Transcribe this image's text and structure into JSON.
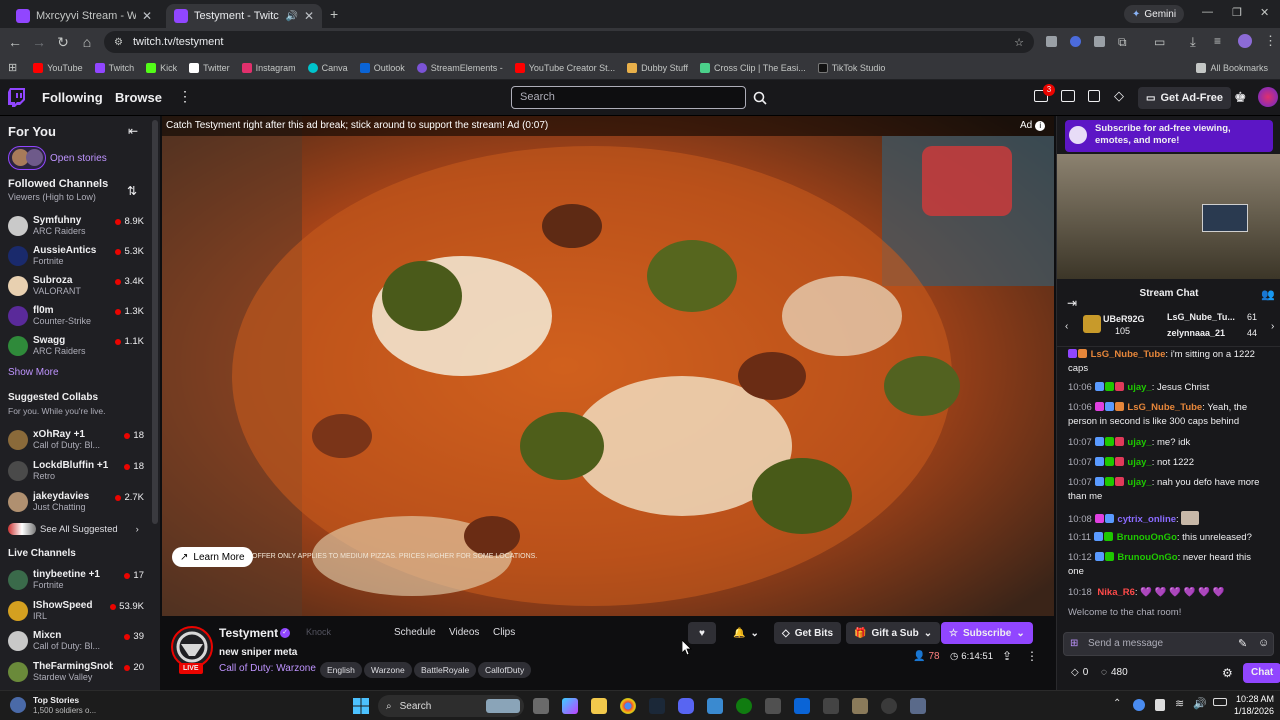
{
  "browser": {
    "tabs": [
      {
        "title": "Mxrcyyvi Stream - Watch Li",
        "active": false
      },
      {
        "title": "Testyment - Twitch",
        "active": true
      }
    ],
    "gemini_label": "Gemini",
    "url": "twitch.tv/testyment",
    "bookmarks": [
      "YouTube",
      "Twitch",
      "Kick",
      "Twitter",
      "Instagram",
      "Canva",
      "Outlook",
      "StreamElements -",
      "YouTube Creator St...",
      "Dubby Stuff",
      "Cross Clip | The Easi...",
      "TikTok Studio"
    ],
    "all_bookmarks": "All Bookmarks"
  },
  "topnav": {
    "following": "Following",
    "browse": "Browse",
    "search_placeholder": "Search",
    "notif_count": "3",
    "get_ad_free": "Get Ad-Free"
  },
  "sidebar": {
    "for_you": "For You",
    "open_stories": "Open stories",
    "followed_title": "Followed Channels",
    "followed_sort": "Viewers (High to Low)",
    "followed": [
      {
        "name": "Symfuhny",
        "game": "ARC Raiders",
        "viewers": "8.9K"
      },
      {
        "name": "AussieAntics",
        "game": "Fortnite",
        "viewers": "5.3K"
      },
      {
        "name": "Subroza",
        "game": "VALORANT",
        "viewers": "3.4K"
      },
      {
        "name": "fl0m",
        "game": "Counter-Strike",
        "viewers": "1.3K"
      },
      {
        "name": "Swagg",
        "game": "ARC Raiders",
        "viewers": "1.1K"
      }
    ],
    "show_more": "Show More",
    "collabs_title": "Suggested Collabs",
    "collabs_sub": "For you. While you're live.",
    "collabs": [
      {
        "name": "xOhRay +1",
        "game": "Call of Duty: Bl...",
        "viewers": "18"
      },
      {
        "name": "LockdBluffin +1",
        "game": "Retro",
        "viewers": "18"
      },
      {
        "name": "jakeydavies",
        "game": "Just Chatting",
        "viewers": "2.7K"
      }
    ],
    "see_all": "See All Suggested",
    "live_title": "Live Channels",
    "live": [
      {
        "name": "tinybeetine +1",
        "game": "Fortnite",
        "viewers": "17"
      },
      {
        "name": "IShowSpeed",
        "game": "IRL",
        "viewers": "53.9K"
      },
      {
        "name": "Mixcn",
        "game": "Call of Duty: Bl...",
        "viewers": "39"
      },
      {
        "name": "TheFarmingSnob",
        "game": "Stardew Valley",
        "viewers": "20"
      }
    ]
  },
  "video": {
    "ad_banner": "Catch Testyment right after this ad break; stick around to support the stream! Ad (0:07)",
    "ad_badge": "Ad",
    "learn_more": "Learn More",
    "disclaimer_1": "OFFER ONLY APPLIES TO MEDIUM PIZZAS. PRICES HIGHER FOR SOME LOCATIONS."
  },
  "channel": {
    "name": "Testyment",
    "title": "new sniper meta",
    "game": "Call of Duty: Warzone",
    "tags": [
      "English",
      "Warzone",
      "BattleRoyale",
      "CallofDuty"
    ],
    "live_label": "LIVE",
    "knock": "Knock",
    "tabs": [
      "Schedule",
      "Videos",
      "Clips"
    ],
    "get_bits": "Get Bits",
    "gift_sub": "Gift a Sub",
    "subscribe": "Subscribe",
    "viewers": "78",
    "uptime": "6:14:51"
  },
  "chat": {
    "promo": "Subscribe for ad-free viewing, emotes, and more!",
    "title": "Stream Chat",
    "gifters": [
      {
        "name": "UBeR92G",
        "count": "105"
      },
      {
        "name": "LsG_Nube_Tu...",
        "count": "61"
      },
      {
        "name": "zelynnaaa_21",
        "count": "44"
      }
    ],
    "messages": [
      {
        "time": "",
        "user": "LsG_Nube_Tube",
        "color": "#e6863a",
        "text": "i'm sitting on a 1222 caps"
      },
      {
        "time": "10:06",
        "user": "ujay_",
        "color": "#1ec800",
        "text": "Jesus Christ"
      },
      {
        "time": "10:06",
        "user": "LsG_Nube_Tube",
        "color": "#e6863a",
        "text": "Yeah, the person in second is like 300 caps behind"
      },
      {
        "time": "10:07",
        "user": "ujay_",
        "color": "#1ec800",
        "text": "me? idk"
      },
      {
        "time": "10:07",
        "user": "ujay_",
        "color": "#1ec800",
        "text": "not 1222"
      },
      {
        "time": "10:07",
        "user": "ujay_",
        "color": "#1ec800",
        "text": "nah you defo have more than me"
      },
      {
        "time": "10:08",
        "user": "cytrix_online",
        "color": "#8a6bff",
        "text": ""
      },
      {
        "time": "10:11",
        "user": "BrunouOnGo",
        "color": "#1ec800",
        "text": "this unreleased?"
      },
      {
        "time": "10:12",
        "user": "BrunouOnGo",
        "color": "#1ec800",
        "text": "never heard this one"
      },
      {
        "time": "10:18",
        "user": "Nika_R6",
        "color": "#ff4a4a",
        "text": "💜 💜 💜 💜 💜 💜"
      }
    ],
    "welcome": "Welcome to the chat room!",
    "input_placeholder": "Send a message",
    "bits": "0",
    "points": "480",
    "chat_button": "Chat"
  },
  "taskbar": {
    "news_title": "Top Stories",
    "news_sub": "1,500 soldiers o...",
    "search": "Search",
    "time": "10:28 AM",
    "date": "1/18/2026"
  }
}
